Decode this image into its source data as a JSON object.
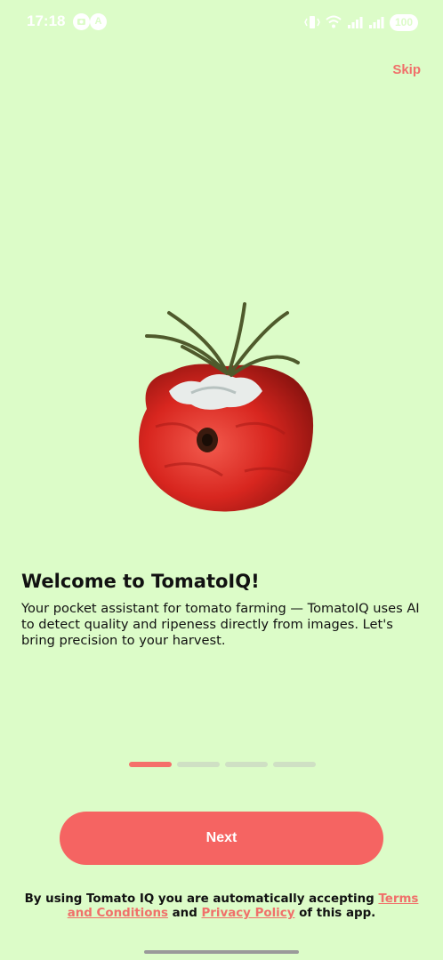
{
  "status_bar": {
    "time": "17:18",
    "notif_icon_1": "camera-notification-icon",
    "notif_icon_2_label": "A",
    "battery": "100",
    "icons": [
      "vibrate-icon",
      "wifi-icon",
      "signal-icon",
      "signal-icon"
    ]
  },
  "onboarding": {
    "skip_label": "Skip",
    "title": "Welcome to TomatoIQ!",
    "description": "Your pocket assistant for tomato farming — TomatoIQ uses AI to detect quality and ripeness directly from images. Let's bring precision to your harvest.",
    "pages": 4,
    "current_page": 1,
    "next_label": "Next"
  },
  "footer": {
    "text_before": "By using Tomato IQ you are automatically accepting ",
    "terms_label": "Terms and Conditions",
    "text_middle": " and ",
    "privacy_label": "Privacy Policy",
    "text_after": " of this app."
  },
  "colors": {
    "background": "#dcfcc8",
    "accent": "#f56462",
    "link": "#f0706a"
  }
}
